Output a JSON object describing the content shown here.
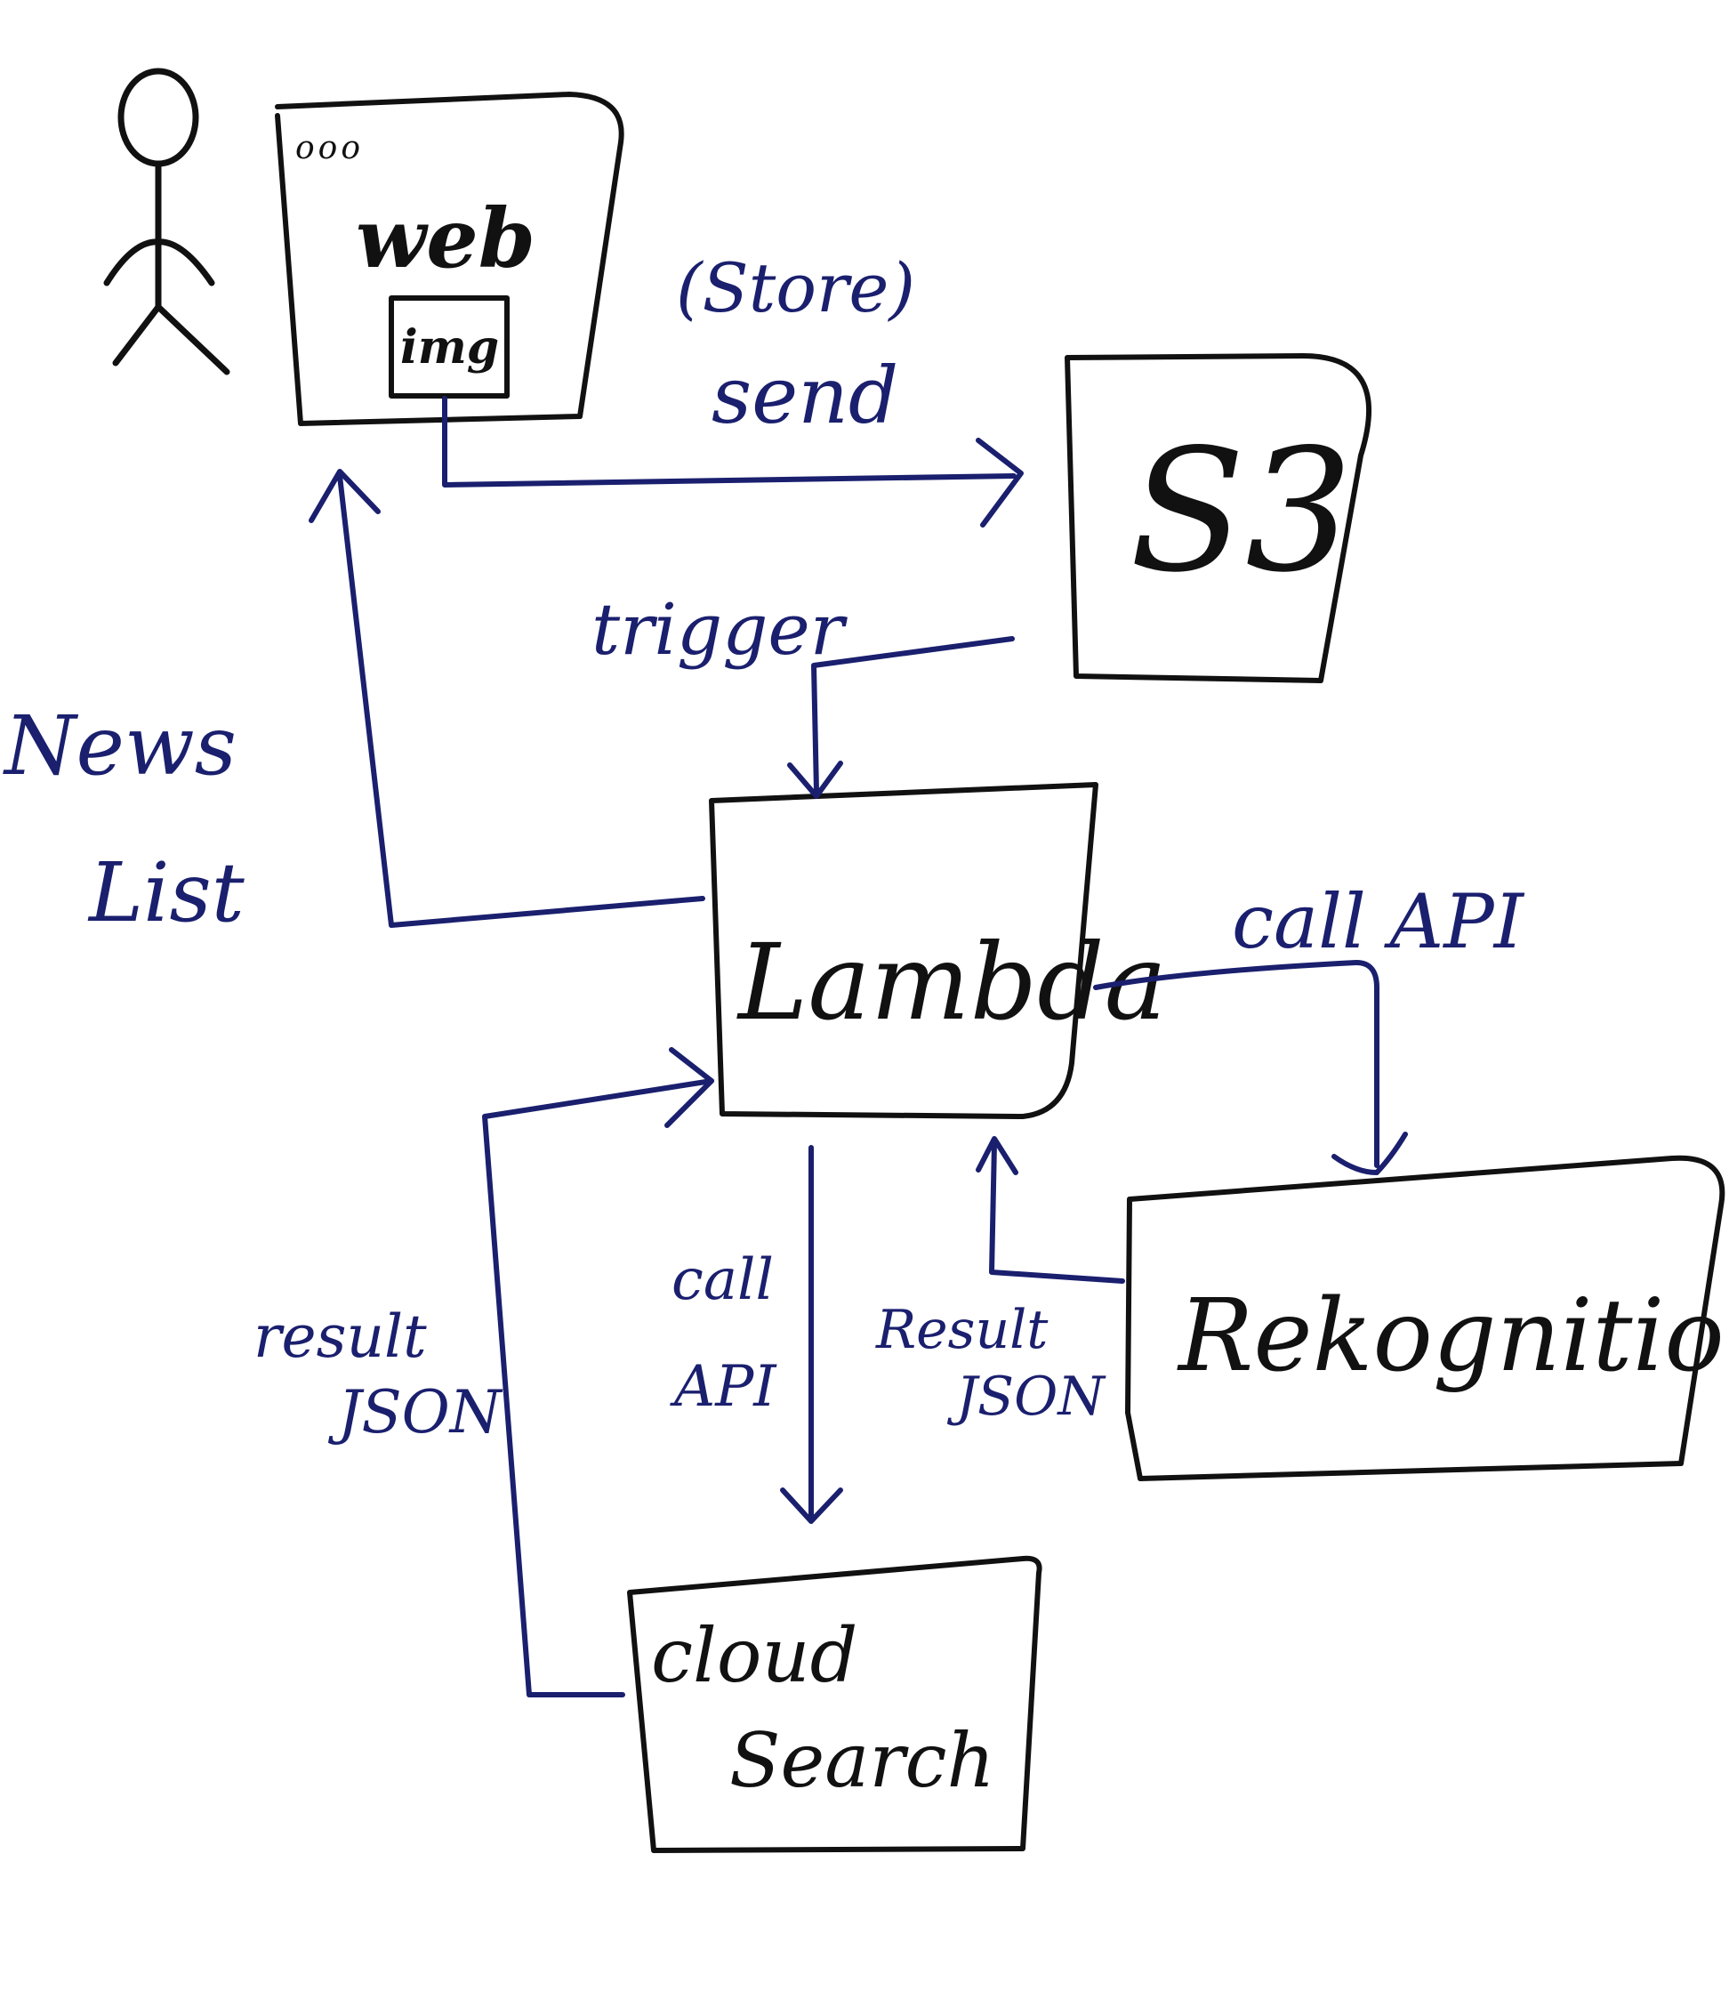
{
  "diagram": {
    "nodes": {
      "web": {
        "label": "web",
        "img_label": "img",
        "dots": "ooo"
      },
      "s3": {
        "label": "S3"
      },
      "lambda": {
        "label": "Lambda"
      },
      "rekognition": {
        "label": "Rekognition"
      },
      "cloudsearch": {
        "label_line1": "cloud",
        "label_line2": "Search"
      }
    },
    "edges": {
      "send": {
        "label_line1": "(Store)",
        "label_line2": "send",
        "from": "web",
        "to": "s3"
      },
      "trigger": {
        "label": "trigger",
        "from": "s3",
        "to": "lambda"
      },
      "call_api_rekognition": {
        "label": "call API",
        "from": "lambda",
        "to": "rekognition"
      },
      "result_rekognition": {
        "label_line1": "Result",
        "label_line2": "JSON",
        "from": "rekognition",
        "to": "lambda"
      },
      "call_api_cloudsearch": {
        "label_line1": "call",
        "label_line2": "API",
        "from": "lambda",
        "to": "cloudsearch"
      },
      "result_cloudsearch": {
        "label_line1": "result",
        "label_line2": "JSON",
        "from": "cloudsearch",
        "to": "lambda"
      },
      "news_list": {
        "label_line1": "News",
        "label_line2": "List",
        "from": "lambda",
        "to": "web"
      }
    },
    "colors": {
      "ink_black": "#111111",
      "ink_blue": "#1a1f6e",
      "background": "#ffffff"
    }
  }
}
